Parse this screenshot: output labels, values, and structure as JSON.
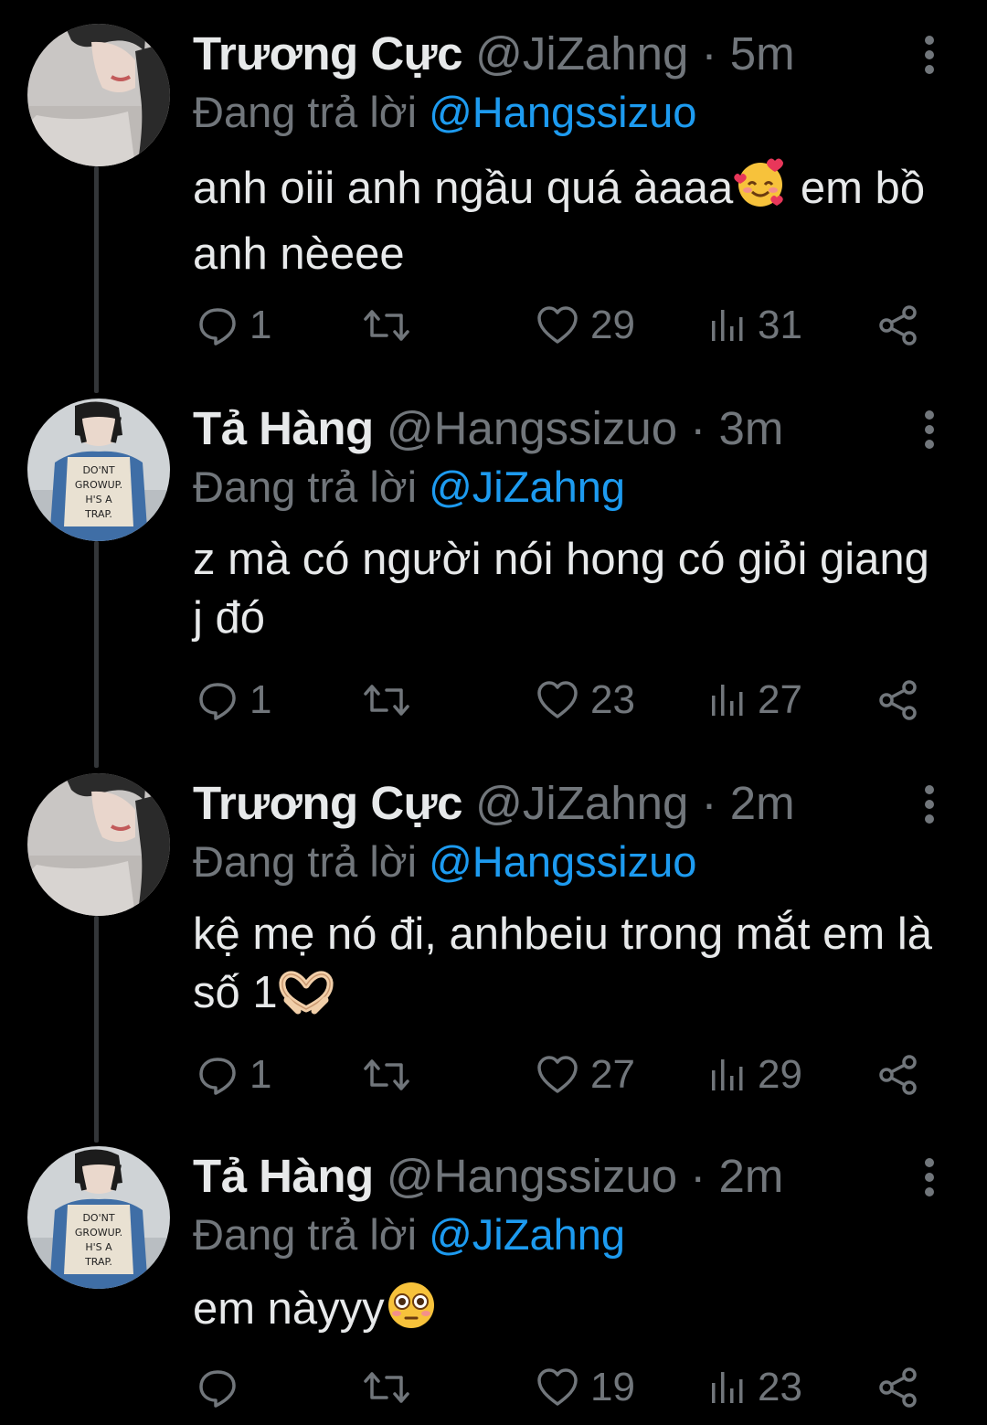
{
  "colors": {
    "background": "#000000",
    "text": "#e7e9ea",
    "secondary": "#71767b",
    "accent": "#1d9bf0",
    "thread_line": "#333639"
  },
  "replying_label": "Đang trả lời",
  "tweets": [
    {
      "name": "Trương Cực",
      "handle": "@JiZahng",
      "dot": "·",
      "time": "5m",
      "replying_to": "@Hangssizuo",
      "text_before": "anh oiii anh ngầu quá àaaa",
      "emoji": "smiling-face-with-hearts",
      "text_after": " em bồ anh nèeee",
      "replies": "1",
      "retweets": "",
      "likes": "29",
      "views": "31"
    },
    {
      "name": "Tả Hàng",
      "handle": "@Hangssizuo",
      "dot": "·",
      "time": "3m",
      "replying_to": "@JiZahng",
      "text_before": "z mà có người nói hong có giỏi giang j đó",
      "emoji": "",
      "text_after": "",
      "replies": "1",
      "retweets": "",
      "likes": "23",
      "views": "27"
    },
    {
      "name": "Trương Cực",
      "handle": "@JiZahng",
      "dot": "·",
      "time": "2m",
      "replying_to": "@Hangssizuo",
      "text_before": "kệ mẹ nó đi, anhbeiu trong mắt em là số 1",
      "emoji": "heart-hands",
      "text_after": "",
      "replies": "1",
      "retweets": "",
      "likes": "27",
      "views": "29"
    },
    {
      "name": "Tả Hàng",
      "handle": "@Hangssizuo",
      "dot": "·",
      "time": "2m",
      "replying_to": "@JiZahng",
      "text_before": "em nàyyy",
      "emoji": "flushed-face",
      "text_after": "",
      "replies": "",
      "retweets": "",
      "likes": "19",
      "views": "23"
    }
  ]
}
